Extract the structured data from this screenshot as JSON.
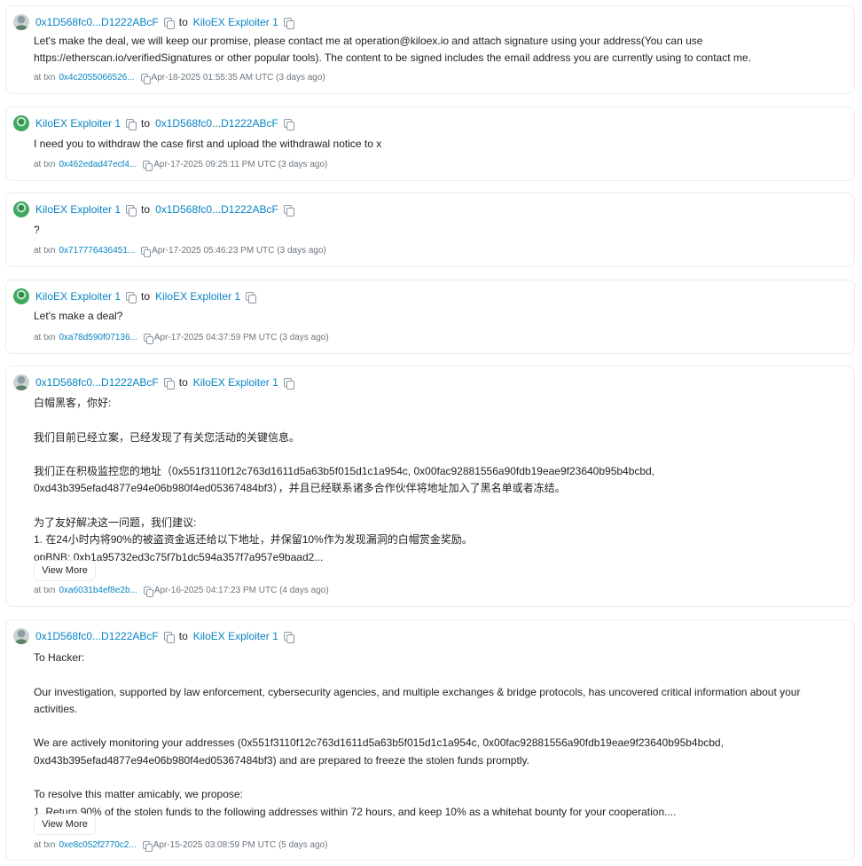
{
  "messages": [
    {
      "from": "0x1D568fc0...D1222ABcF",
      "to_word": "to",
      "to": "KiloEX Exploiter 1",
      "from_avatar": "grey",
      "body": "Let's make the deal, we will keep our promise, please contact me at operation@kiloex.io and attach signature using your address(You can use\nhttps://etherscan.io/verifiedSignatures or other popular tools). The content to be signed includes the email address you are currently using to contact me.",
      "at_txn": "at txn",
      "txn": "0x4c2055066526...",
      "timestamp": "Apr-18-2025 01:55:35 AM UTC (3 days ago)"
    },
    {
      "from": "KiloEX Exploiter 1",
      "to_word": "to",
      "to": "0x1D568fc0...D1222ABcF",
      "from_avatar": "green",
      "body": "I need you to withdraw the case first and upload the withdrawal notice to x",
      "at_txn": "at txn",
      "txn": "0x462edad47ecf4...",
      "timestamp": "Apr-17-2025 09:25:11 PM UTC (3 days ago)"
    },
    {
      "from": "KiloEX Exploiter 1",
      "to_word": "to",
      "to": "0x1D568fc0...D1222ABcF",
      "from_avatar": "green",
      "body": "?",
      "at_txn": "at txn",
      "txn": "0x717776436451...",
      "timestamp": "Apr-17-2025 05:46:23 PM UTC (3 days ago)"
    },
    {
      "from": "KiloEX Exploiter 1",
      "to_word": "to",
      "to": "KiloEX Exploiter 1",
      "from_avatar": "green",
      "body": "Let's make a deal?",
      "at_txn": "at txn",
      "txn": "0xa78d590f07136...",
      "timestamp": "Apr-17-2025 04:37:59 PM UTC (3 days ago)"
    },
    {
      "from": "0x1D568fc0...D1222ABcF",
      "to_word": "to",
      "to": "KiloEX Exploiter 1",
      "from_avatar": "grey",
      "body": "白帽黑客，你好:\n\n我们目前已经立案，已经发现了有关您活动的关键信息。\n\n我们正在积极监控您的地址（0x551f3110f12c763d1611d5a63b5f015d1c1a954c, 0x00fac92881556a90fdb19eae9f23640b95b4bcbd,\n0xd43b395efad4877e94e06b980f4ed05367484bf3），并且已经联系诸多合作伙伴将地址加入了黑名单或者冻结。\n\n为了友好解决这一问题，我们建议:\n1. 在24小时内将90%的被盗资金返还给以下地址，并保留10%作为发现漏洞的白帽赏金奖励。\nopBNB: 0xb1a95732ed3c75f7b1dc594a357f7a957e9baad2...",
      "view_more": "View More",
      "at_txn": "at txn",
      "txn": "0xa6031b4ef8e2b...",
      "timestamp": "Apr-16-2025 04:17:23 PM UTC (4 days ago)"
    },
    {
      "from": "0x1D568fc0...D1222ABcF",
      "to_word": "to",
      "to": "KiloEX Exploiter 1",
      "from_avatar": "grey",
      "body": "To Hacker:\n\nOur investigation, supported by law enforcement, cybersecurity agencies, and multiple exchanges & bridge protocols, has uncovered critical information about your\nactivities.\n\nWe are actively monitoring your addresses (0x551f3110f12c763d1611d5a63b5f015d1c1a954c, 0x00fac92881556a90fdb19eae9f23640b95b4bcbd,\n0xd43b395efad4877e94e06b980f4ed05367484bf3) and are prepared to freeze the stolen funds promptly.\n\nTo resolve this matter amicably, we propose:\n1. Return 90% of the stolen funds to the following addresses within 72 hours, and keep 10% as a whitehat bounty for your cooperation....",
      "view_more": "View More",
      "at_txn": "at txn",
      "txn": "0xe8c052f2770c2...",
      "timestamp": "Apr-15-2025 03:08:59 PM UTC (5 days ago)"
    }
  ]
}
